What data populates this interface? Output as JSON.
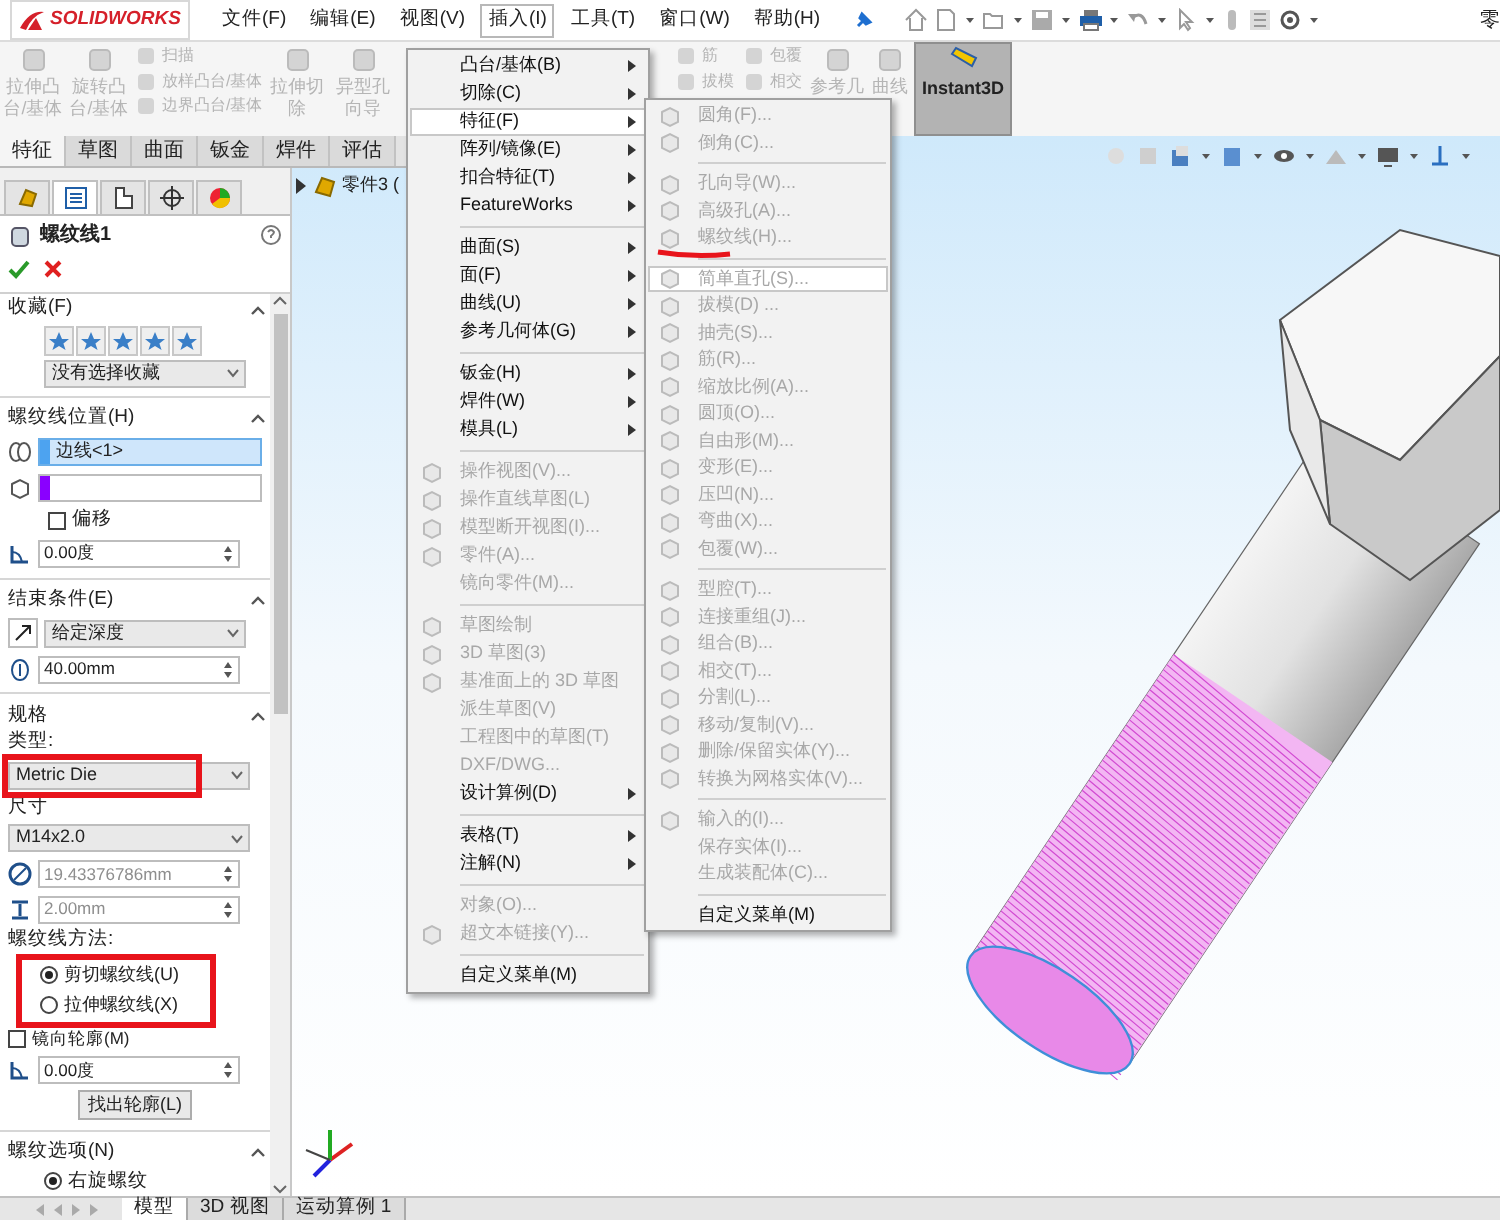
{
  "logo": {
    "text": "SOLIDWORKS"
  },
  "menu_bar": [
    {
      "label": "文件(F)",
      "selected": false
    },
    {
      "label": "编辑(E)",
      "selected": false
    },
    {
      "label": "视图(V)",
      "selected": false
    },
    {
      "label": "插入(I)",
      "selected": true
    },
    {
      "label": "工具(T)",
      "selected": false
    },
    {
      "label": "窗口(W)",
      "selected": false
    },
    {
      "label": "帮助(H)",
      "selected": false
    }
  ],
  "title_fragment": "零",
  "ribbon": {
    "left": [
      {
        "kind": "large",
        "label": "拉伸凸台/基体",
        "disabled": true
      },
      {
        "kind": "large",
        "label": "旋转凸台/基体",
        "disabled": true
      },
      {
        "kind": "stack",
        "items": [
          {
            "label": "扫描",
            "disabled": true
          },
          {
            "label": "放样凸台/基体",
            "disabled": true
          },
          {
            "label": "边界凸台/基体",
            "disabled": true
          }
        ]
      },
      {
        "kind": "large",
        "label": "拉伸切除",
        "disabled": true
      },
      {
        "kind": "large",
        "label": "异型孔向导",
        "disabled": true
      }
    ],
    "right": [
      {
        "kind": "stack",
        "items": [
          {
            "label": "筋",
            "disabled": true
          },
          {
            "label": "拔模",
            "disabled": true
          }
        ]
      },
      {
        "kind": "stack",
        "items": [
          {
            "label": "包覆",
            "disabled": true
          },
          {
            "label": "相交",
            "disabled": true
          }
        ]
      },
      {
        "kind": "large",
        "label": "参考几",
        "disabled": true
      },
      {
        "kind": "large",
        "label": "曲线",
        "disabled": true
      },
      {
        "kind": "large",
        "label": "Instant3D",
        "disabled": false,
        "selected": true
      }
    ]
  },
  "command_tabs": [
    {
      "label": "特征",
      "selected": true
    },
    {
      "label": "草图",
      "selected": false
    },
    {
      "label": "曲面",
      "selected": false
    },
    {
      "label": "钣金",
      "selected": false
    },
    {
      "label": "焊件",
      "selected": false
    },
    {
      "label": "评估",
      "selected": false
    }
  ],
  "property_manager": {
    "tabs": [
      {
        "selected": false
      },
      {
        "selected": true
      },
      {
        "selected": false
      },
      {
        "selected": false
      },
      {
        "selected": false
      }
    ],
    "title": "螺纹线1",
    "favorites": {
      "title": "收藏(F)",
      "expanded": true,
      "dropdown": "没有选择收藏"
    },
    "thread_location": {
      "title": "螺纹线位置(H)",
      "expanded": true,
      "selections": [
        {
          "value": "边线<1>",
          "color": "#4da3f0",
          "active": true
        },
        {
          "color": "#8a00ff",
          "active": false
        }
      ],
      "offset": {
        "label": "偏移",
        "checked": false
      },
      "angle": "0.00度"
    },
    "end_condition": {
      "title": "结束条件(E)",
      "expanded": true,
      "dropdown": "给定深度",
      "depth": "40.00mm"
    },
    "specification": {
      "title": "规格",
      "expanded": true,
      "type_label": "类型:",
      "type": "Metric Die",
      "size_label": "尺寸",
      "size": "M14x2.0",
      "fields": [
        {
          "value": "19.43376786mm",
          "disabled": true
        },
        {
          "value": "2.00mm",
          "disabled": true
        }
      ],
      "method_label": "螺纹线方法:",
      "methods": [
        {
          "label": "剪切螺纹线(U)",
          "selected": true
        },
        {
          "label": "拉伸螺纹线(X)",
          "selected": false
        }
      ],
      "mirror": {
        "label": "镜向轮廓(M)",
        "checked": false
      },
      "angle": "0.00度",
      "button": "找出轮廓(L)"
    },
    "thread_options": {
      "title": "螺纹选项(N)",
      "expanded": true,
      "options": [
        {
          "label": "右旋螺纹",
          "selected": true
        }
      ]
    }
  },
  "tree": {
    "expanded": false,
    "label": "零件3 ("
  },
  "insert_menu": {
    "sections": [
      {
        "items": [
          {
            "label": "凸台/基体(B)",
            "submenu": true,
            "disabled": false,
            "selected": false,
            "icon": false
          },
          {
            "label": "切除(C)",
            "submenu": true,
            "disabled": false,
            "selected": false,
            "icon": false
          },
          {
            "label": "特征(F)",
            "submenu": true,
            "disabled": false,
            "selected": true,
            "icon": false
          },
          {
            "label": "阵列/镜像(E)",
            "submenu": true,
            "disabled": false,
            "selected": false,
            "icon": false
          },
          {
            "label": "扣合特征(T)",
            "submenu": true,
            "disabled": false,
            "selected": false,
            "icon": false
          },
          {
            "label": "FeatureWorks",
            "submenu": true,
            "disabled": false,
            "selected": false,
            "icon": false
          }
        ]
      },
      {
        "items": [
          {
            "label": "曲面(S)",
            "submenu": true,
            "disabled": false,
            "selected": false,
            "icon": false
          },
          {
            "label": "面(F)",
            "submenu": true,
            "disabled": false,
            "selected": false,
            "icon": false
          },
          {
            "label": "曲线(U)",
            "submenu": true,
            "disabled": false,
            "selected": false,
            "icon": false
          },
          {
            "label": "参考几何体(G)",
            "submenu": true,
            "disabled": false,
            "selected": false,
            "icon": false
          }
        ]
      },
      {
        "items": [
          {
            "label": "钣金(H)",
            "submenu": true,
            "disabled": false,
            "selected": false,
            "icon": false
          },
          {
            "label": "焊件(W)",
            "submenu": true,
            "disabled": false,
            "selected": false,
            "icon": false
          },
          {
            "label": "模具(L)",
            "submenu": true,
            "disabled": false,
            "selected": false,
            "icon": false
          }
        ]
      },
      {
        "items": [
          {
            "label": "操作视图(V)...",
            "submenu": false,
            "disabled": true,
            "selected": false,
            "icon": true
          },
          {
            "label": "操作直线草图(L)",
            "submenu": false,
            "disabled": true,
            "selected": false,
            "icon": true
          },
          {
            "label": "模型断开视图(I)...",
            "submenu": false,
            "disabled": true,
            "selected": false,
            "icon": true
          },
          {
            "label": "零件(A)...",
            "submenu": false,
            "disabled": true,
            "selected": false,
            "icon": true
          },
          {
            "label": "镜向零件(M)...",
            "submenu": false,
            "disabled": true,
            "selected": false,
            "icon": false
          }
        ]
      },
      {
        "items": [
          {
            "label": "草图绘制",
            "submenu": false,
            "disabled": true,
            "selected": false,
            "icon": true
          },
          {
            "label": "3D 草图(3)",
            "submenu": false,
            "disabled": true,
            "selected": false,
            "icon": true
          },
          {
            "label": "基准面上的 3D 草图",
            "submenu": false,
            "disabled": true,
            "selected": false,
            "icon": true
          },
          {
            "label": "派生草图(V)",
            "submenu": false,
            "disabled": true,
            "selected": false,
            "icon": false
          },
          {
            "label": "工程图中的草图(T)",
            "submenu": false,
            "disabled": true,
            "selected": false,
            "icon": false
          },
          {
            "label": "DXF/DWG...",
            "submenu": false,
            "disabled": true,
            "selected": false,
            "icon": false
          },
          {
            "label": "设计算例(D)",
            "submenu": true,
            "disabled": false,
            "selected": false,
            "icon": false
          }
        ]
      },
      {
        "items": [
          {
            "label": "表格(T)",
            "submenu": true,
            "disabled": false,
            "selected": false,
            "icon": false
          },
          {
            "label": "注解(N)",
            "submenu": true,
            "disabled": false,
            "selected": false,
            "icon": false
          }
        ]
      },
      {
        "items": [
          {
            "label": "对象(O)...",
            "submenu": false,
            "disabled": true,
            "selected": false,
            "icon": false
          },
          {
            "label": "超文本链接(Y)...",
            "submenu": false,
            "disabled": true,
            "selected": false,
            "icon": true
          }
        ]
      },
      {
        "items": [
          {
            "label": "自定义菜单(M)",
            "submenu": false,
            "disabled": false,
            "selected": false,
            "icon": false
          }
        ]
      }
    ]
  },
  "feature_submenu": {
    "sections": [
      {
        "items": [
          {
            "label": "圆角(F)...",
            "disabled": true,
            "selected": false,
            "icon": true
          },
          {
            "label": "倒角(C)...",
            "disabled": true,
            "selected": false,
            "icon": true
          }
        ]
      },
      {
        "items": [
          {
            "label": "孔向导(W)...",
            "disabled": true,
            "selected": false,
            "icon": true
          },
          {
            "label": "高级孔(A)...",
            "disabled": true,
            "selected": false,
            "icon": true
          },
          {
            "label": "螺纹线(H)...",
            "disabled": true,
            "selected": false,
            "icon": true
          }
        ]
      },
      {
        "items": [
          {
            "label": "简单直孔(S)...",
            "disabled": true,
            "selected": true,
            "icon": true
          },
          {
            "label": "拔模(D) ...",
            "disabled": true,
            "selected": false,
            "icon": true
          },
          {
            "label": "抽壳(S)...",
            "disabled": true,
            "selected": false,
            "icon": true
          },
          {
            "label": "筋(R)...",
            "disabled": true,
            "selected": false,
            "icon": true
          },
          {
            "label": "缩放比例(A)...",
            "disabled": true,
            "selected": false,
            "icon": true
          },
          {
            "label": "圆顶(O)...",
            "disabled": true,
            "selected": false,
            "icon": true
          },
          {
            "label": "自由形(M)...",
            "disabled": true,
            "selected": false,
            "icon": true
          },
          {
            "label": "变形(E)...",
            "disabled": true,
            "selected": false,
            "icon": true
          },
          {
            "label": "压凹(N)...",
            "disabled": true,
            "selected": false,
            "icon": true
          },
          {
            "label": "弯曲(X)...",
            "disabled": true,
            "selected": false,
            "icon": true
          },
          {
            "label": "包覆(W)...",
            "disabled": true,
            "selected": false,
            "icon": true
          }
        ]
      },
      {
        "items": [
          {
            "label": "型腔(T)...",
            "disabled": true,
            "selected": false,
            "icon": true
          },
          {
            "label": "连接重组(J)...",
            "disabled": true,
            "selected": false,
            "icon": true
          },
          {
            "label": "组合(B)...",
            "disabled": true,
            "selected": false,
            "icon": true
          },
          {
            "label": "相交(T)...",
            "disabled": true,
            "selected": false,
            "icon": true
          },
          {
            "label": "分割(L)...",
            "disabled": true,
            "selected": false,
            "icon": true
          },
          {
            "label": "移动/复制(V)...",
            "disabled": true,
            "selected": false,
            "icon": true
          },
          {
            "label": "删除/保留实体(Y)...",
            "disabled": true,
            "selected": false,
            "icon": true
          },
          {
            "label": "转换为网格实体(V)...",
            "disabled": true,
            "selected": false,
            "icon": true
          }
        ]
      },
      {
        "items": [
          {
            "label": "输入的(I)...",
            "disabled": true,
            "selected": false,
            "icon": true
          },
          {
            "label": "保存实体(I)...",
            "disabled": true,
            "selected": false,
            "icon": false
          },
          {
            "label": "生成装配体(C)...",
            "disabled": true,
            "selected": false,
            "icon": false
          }
        ]
      },
      {
        "items": [
          {
            "label": "自定义菜单(M)",
            "disabled": false,
            "selected": false,
            "icon": false
          }
        ]
      }
    ]
  },
  "bottom_tabs": [
    {
      "label": "模型",
      "selected": true
    },
    {
      "label": "3D 视图",
      "selected": false
    },
    {
      "label": "运动算例 1",
      "selected": false
    }
  ]
}
